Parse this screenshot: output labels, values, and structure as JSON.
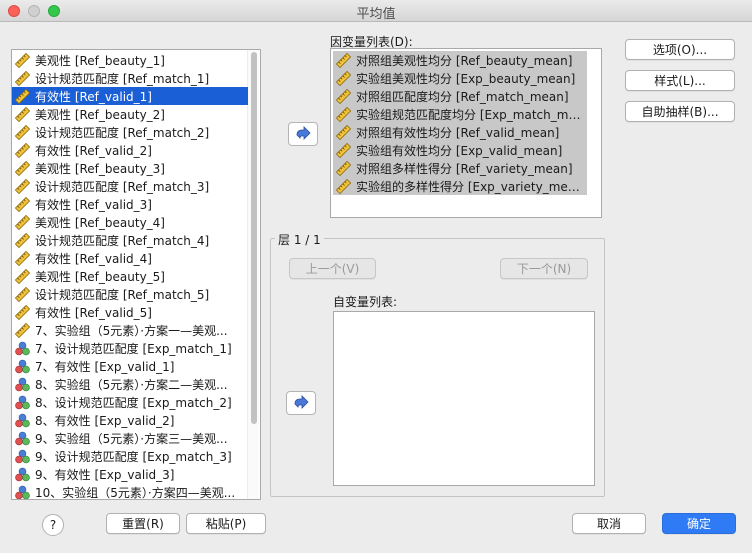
{
  "window": {
    "title": "平均值"
  },
  "source_list": {
    "selected_index": 2,
    "items": [
      {
        "label": "美观性 [Ref_beauty_1]",
        "icon": "ruler-icon"
      },
      {
        "label": "设计规范匹配度 [Ref_match_1]",
        "icon": "ruler-icon"
      },
      {
        "label": "有效性 [Ref_valid_1]",
        "icon": "ruler-icon"
      },
      {
        "label": "美观性 [Ref_beauty_2]",
        "icon": "ruler-icon"
      },
      {
        "label": "设计规范匹配度 [Ref_match_2]",
        "icon": "ruler-icon"
      },
      {
        "label": "有效性 [Ref_valid_2]",
        "icon": "ruler-icon"
      },
      {
        "label": "美观性 [Ref_beauty_3]",
        "icon": "ruler-icon"
      },
      {
        "label": "设计规范匹配度 [Ref_match_3]",
        "icon": "ruler-icon"
      },
      {
        "label": "有效性 [Ref_valid_3]",
        "icon": "ruler-icon"
      },
      {
        "label": "美观性 [Ref_beauty_4]",
        "icon": "ruler-icon"
      },
      {
        "label": "设计规范匹配度 [Ref_match_4]",
        "icon": "ruler-icon"
      },
      {
        "label": "有效性 [Ref_valid_4]",
        "icon": "ruler-icon"
      },
      {
        "label": "美观性 [Ref_beauty_5]",
        "icon": "ruler-icon"
      },
      {
        "label": "设计规范匹配度 [Ref_match_5]",
        "icon": "ruler-icon"
      },
      {
        "label": "有效性 [Ref_valid_5]",
        "icon": "ruler-icon"
      },
      {
        "label": "7、实验组（5元素）·方案一—美观...",
        "icon": "ruler-icon"
      },
      {
        "label": "7、设计规范匹配度 [Exp_match_1]",
        "icon": "nominal-icon"
      },
      {
        "label": "7、有效性 [Exp_valid_1]",
        "icon": "nominal-icon"
      },
      {
        "label": "8、实验组（5元素）·方案二—美观...",
        "icon": "nominal-icon"
      },
      {
        "label": "8、设计规范匹配度 [Exp_match_2]",
        "icon": "nominal-icon"
      },
      {
        "label": "8、有效性 [Exp_valid_2]",
        "icon": "nominal-icon"
      },
      {
        "label": "9、实验组（5元素）·方案三—美观...",
        "icon": "nominal-icon"
      },
      {
        "label": "9、设计规范匹配度 [Exp_match_3]",
        "icon": "nominal-icon"
      },
      {
        "label": "9、有效性 [Exp_valid_3]",
        "icon": "nominal-icon"
      },
      {
        "label": "10、实验组（5元素）·方案四—美观...",
        "icon": "nominal-icon"
      }
    ]
  },
  "dependent": {
    "label": "因变量列表(D):",
    "items": [
      "对照组美观性均分 [Ref_beauty_mean]",
      "实验组美观性均分 [Exp_beauty_mean]",
      "对照组匹配度均分 [Ref_match_mean]",
      "实验组规范匹配度均分 [Exp_match_me...",
      "对照组有效性均分 [Ref_valid_mean]",
      "实验组有效性均分 [Exp_valid_mean]",
      "对照组多样性得分 [Ref_variety_mean]",
      "实验组的多样性得分 [Exp_variety_mean]"
    ]
  },
  "layer": {
    "label": "层 1 / 1",
    "prev_label": "上一个(V)",
    "next_label": "下一个(N)",
    "independent_label": "自变量列表:"
  },
  "side_buttons": {
    "options": "选项(O)...",
    "style": "样式(L)...",
    "bootstrap": "自助抽样(B)..."
  },
  "footer": {
    "help": "?",
    "reset": "重置(R)",
    "paste": "粘贴(P)",
    "cancel": "取消",
    "ok": "确定"
  },
  "colors": {
    "selection": "#1a5fd6",
    "primary_button": "#2f7bf5",
    "dependent_highlight": "#c8c8c8"
  }
}
